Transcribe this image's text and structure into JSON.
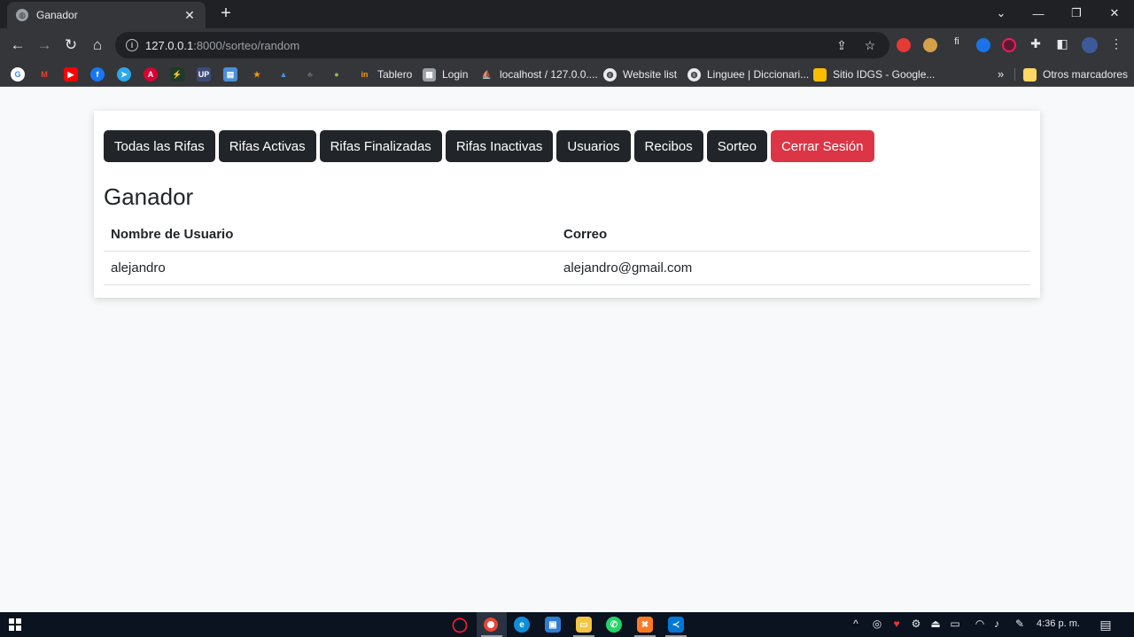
{
  "browser": {
    "tab_title": "Ganador",
    "url_host": "127.0.0.1",
    "url_path": ":8000/sorteo/random",
    "bookmarks": [
      {
        "label": "Tablero"
      },
      {
        "label": "Login"
      },
      {
        "label": "localhost / 127.0.0...."
      },
      {
        "label": "Website list"
      },
      {
        "label": "Linguee | Diccionari..."
      },
      {
        "label": "Sitio IDGS - Google..."
      },
      {
        "label": "Otros marcadores"
      }
    ],
    "more_label": "»"
  },
  "nav": {
    "items": [
      {
        "label": "Todas las Rifas"
      },
      {
        "label": "Rifas Activas"
      },
      {
        "label": "Rifas Finalizadas"
      },
      {
        "label": "Rifas Inactivas"
      },
      {
        "label": "Usuarios"
      },
      {
        "label": "Recibos"
      },
      {
        "label": "Sorteo"
      }
    ],
    "logout_label": "Cerrar Sesión"
  },
  "page": {
    "title": "Ganador"
  },
  "table": {
    "headers": [
      "Nombre de Usuario",
      "Correo"
    ],
    "rows": [
      [
        "alejandro",
        "alejandro@gmail.com"
      ]
    ]
  },
  "taskbar": {
    "clock": "4:36 p. m."
  },
  "colors": {
    "nav_button": "#212529",
    "logout_button": "#dc3545",
    "page_background": "#f8f9fa"
  }
}
